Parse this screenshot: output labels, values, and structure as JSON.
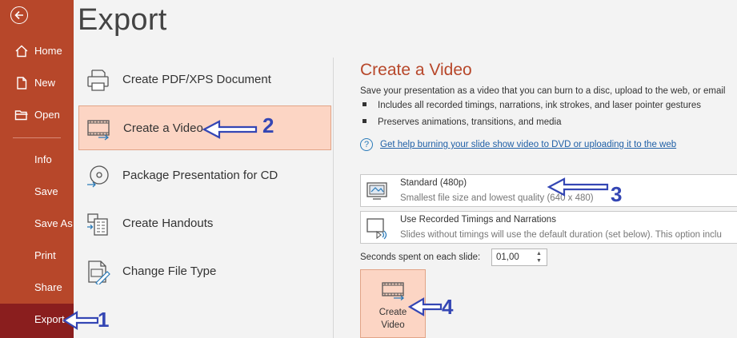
{
  "sidebar": {
    "items": [
      {
        "label": "Home",
        "icon": "home-icon"
      },
      {
        "label": "New",
        "icon": "new-document-icon"
      },
      {
        "label": "Open",
        "icon": "folder-open-icon"
      },
      {
        "label": "Info"
      },
      {
        "label": "Save"
      },
      {
        "label": "Save As"
      },
      {
        "label": "Print"
      },
      {
        "label": "Share"
      },
      {
        "label": "Export"
      }
    ],
    "selected": "Export",
    "color": "#b7472a"
  },
  "page": {
    "title": "Export"
  },
  "export_options": [
    {
      "label": "Create PDF/XPS Document",
      "icon": "pdf-document-icon"
    },
    {
      "label": "Create a Video",
      "icon": "video-icon"
    },
    {
      "label": "Package Presentation for CD",
      "icon": "cd-icon"
    },
    {
      "label": "Create Handouts",
      "icon": "handouts-icon"
    },
    {
      "label": "Change File Type",
      "icon": "file-type-icon"
    }
  ],
  "right_pane": {
    "title": "Create a Video",
    "description": "Save your presentation as a video that you can burn to a disc, upload to the web, or email",
    "bullets": [
      "Includes all recorded timings, narrations, ink strokes, and laser pointer gestures",
      "Preserves animations, transitions, and media"
    ],
    "help_link": "Get help burning your slide show video to DVD or uploading it to the web",
    "quality": {
      "main": "Standard (480p)",
      "sub": "Smallest file size and lowest quality (640 x 480)"
    },
    "timings": {
      "main": "Use Recorded Timings and Narrations",
      "sub": "Slides without timings will use the default duration (set below). This option inclu"
    },
    "seconds_label": "Seconds spent on each slide:",
    "seconds_value": "01,00",
    "create_button": {
      "line1": "Create",
      "line2": "Video"
    }
  },
  "annotations": [
    "1",
    "2",
    "3",
    "4"
  ]
}
